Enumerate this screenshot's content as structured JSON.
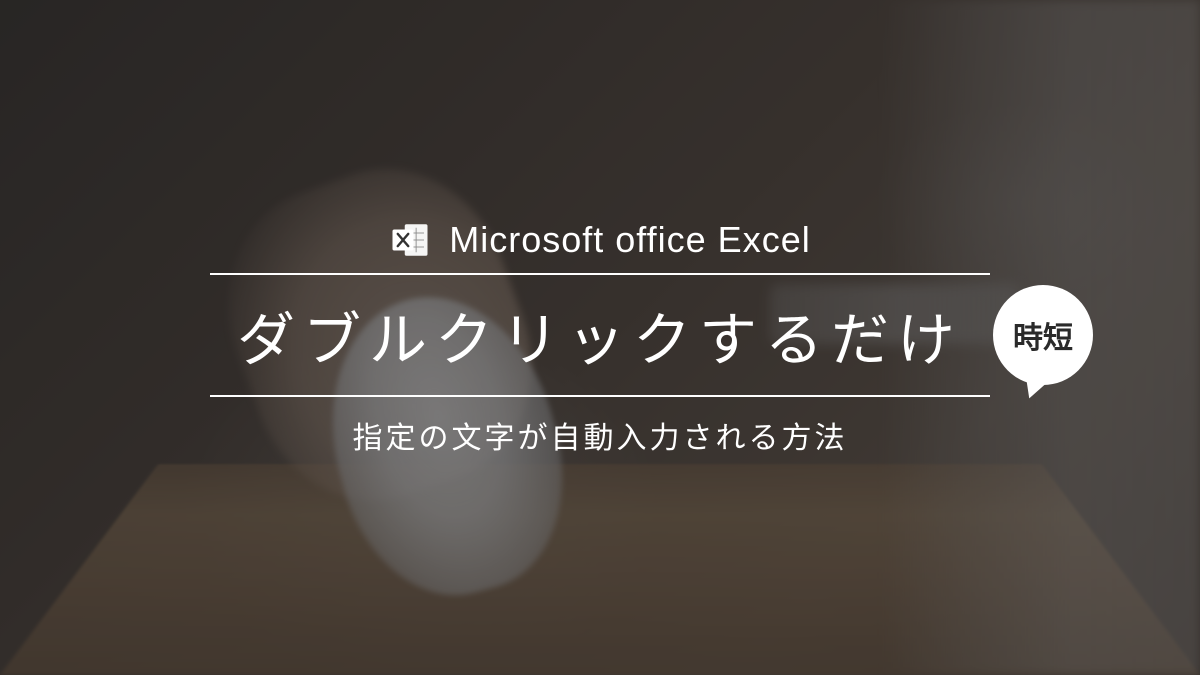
{
  "header": {
    "product_name": "Microsoft office Excel"
  },
  "main": {
    "title": "ダブルクリックするだけ",
    "badge": "時短",
    "subtitle": "指定の文字が自動入力される方法"
  }
}
